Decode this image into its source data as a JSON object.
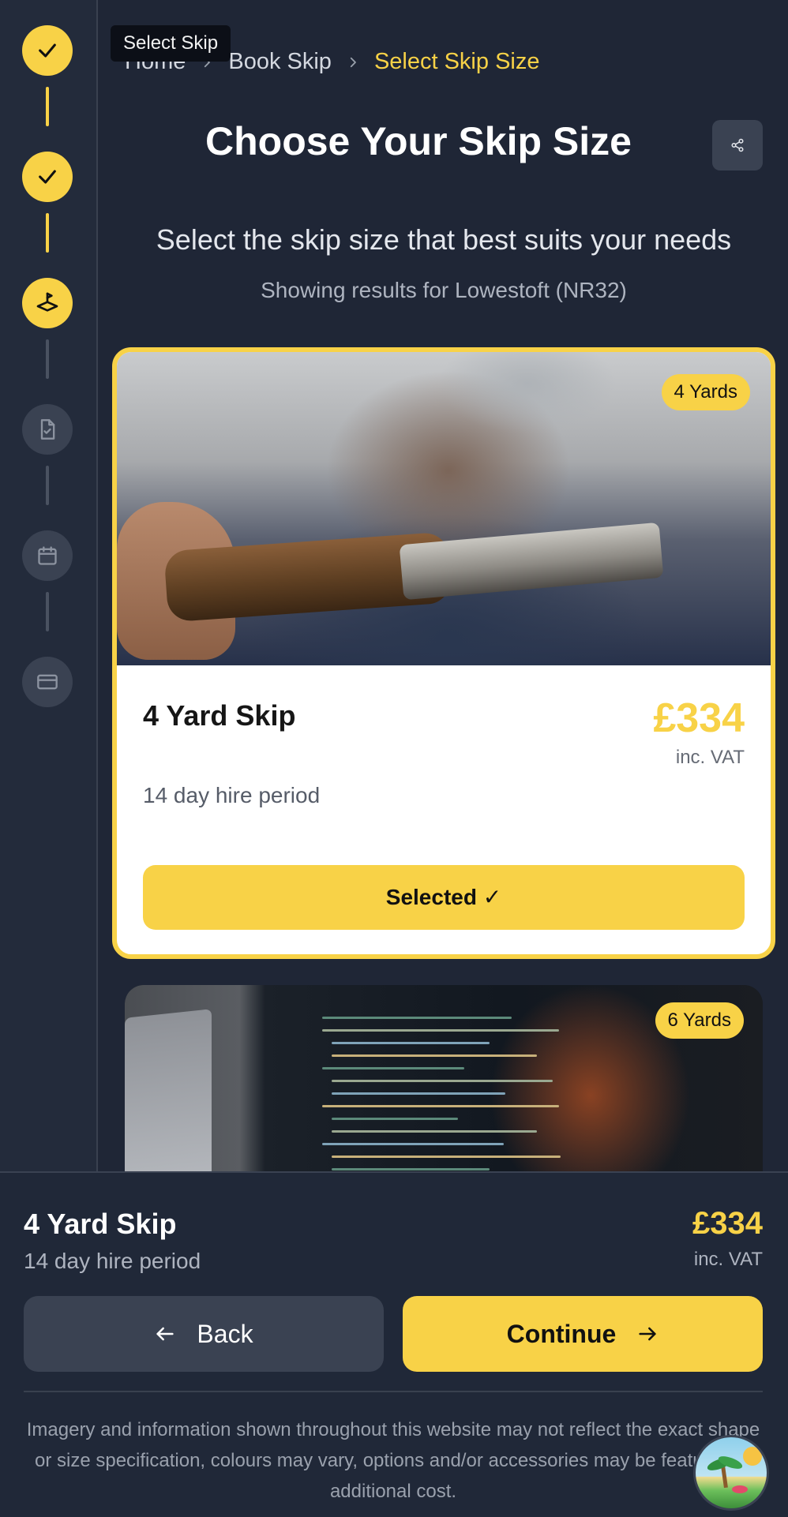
{
  "stepper": {
    "tooltip": "Select Skip",
    "steps": [
      {
        "state": "done",
        "icon": "check-icon"
      },
      {
        "state": "done",
        "icon": "check-icon"
      },
      {
        "state": "active",
        "icon": "skip-icon"
      },
      {
        "state": "pending",
        "icon": "document-check-icon"
      },
      {
        "state": "pending",
        "icon": "calendar-icon"
      },
      {
        "state": "pending",
        "icon": "credit-card-icon"
      }
    ]
  },
  "breadcrumb": {
    "home": "Home",
    "book": "Book Skip",
    "current": "Select Skip Size"
  },
  "header": {
    "title": "Choose Your Skip Size",
    "subtitle": "Select the skip size that best suits your needs",
    "location": "Showing results for Lowestoft (NR32)"
  },
  "cards": [
    {
      "badge": "4 Yards",
      "name": "4 Yard Skip",
      "price": "£334",
      "vat": "inc. VAT",
      "hire": "14 day hire period",
      "button": "Selected ✓",
      "selected": true
    },
    {
      "badge": "6 Yards"
    }
  ],
  "summary": {
    "name": "4 Yard Skip",
    "hire": "14 day hire period",
    "price": "£334",
    "vat": "inc. VAT"
  },
  "actions": {
    "back": "Back",
    "continue": "Continue"
  },
  "disclaimer": "Imagery and information shown throughout this website may not reflect the exact shape or size specification, colours may vary, options and/or accessories may be featured at additional cost.",
  "colors": {
    "accent": "#f8d247",
    "background": "#1f2636",
    "surface": "#3a4252"
  }
}
